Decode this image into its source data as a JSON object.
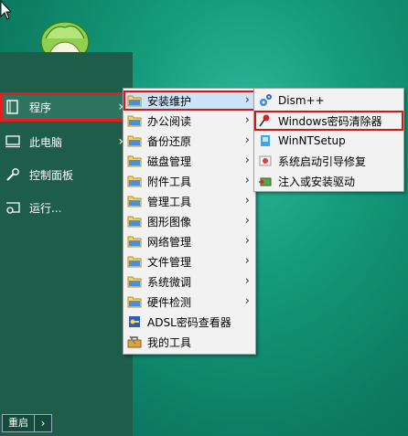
{
  "start_menu": {
    "items": [
      {
        "label": "程序",
        "icon": "programs-icon"
      },
      {
        "label": "此电脑",
        "icon": "computer-icon"
      },
      {
        "label": "控制面板",
        "icon": "wrench-icon"
      },
      {
        "label": "运行...",
        "icon": "run-icon"
      }
    ],
    "restart_label": "重启"
  },
  "programs_menu": {
    "items": [
      {
        "label": "安装维护",
        "icon": "folder-icon",
        "has_submenu": true
      },
      {
        "label": "办公阅读",
        "icon": "folder-icon",
        "has_submenu": true
      },
      {
        "label": "备份还原",
        "icon": "folder-icon",
        "has_submenu": true
      },
      {
        "label": "磁盘管理",
        "icon": "folder-icon",
        "has_submenu": true
      },
      {
        "label": "附件工具",
        "icon": "folder-icon",
        "has_submenu": true
      },
      {
        "label": "管理工具",
        "icon": "folder-icon",
        "has_submenu": true
      },
      {
        "label": "图形图像",
        "icon": "folder-icon",
        "has_submenu": true
      },
      {
        "label": "网络管理",
        "icon": "folder-icon",
        "has_submenu": true
      },
      {
        "label": "文件管理",
        "icon": "folder-icon",
        "has_submenu": true
      },
      {
        "label": "系统微调",
        "icon": "folder-icon",
        "has_submenu": true
      },
      {
        "label": "硬件检测",
        "icon": "folder-icon",
        "has_submenu": true
      },
      {
        "label": "ADSL密码查看器",
        "icon": "key-tool-icon",
        "has_submenu": false
      },
      {
        "label": "我的工具",
        "icon": "toolbox-icon",
        "has_submenu": false
      }
    ]
  },
  "install_menu": {
    "items": [
      {
        "label": "Dism++",
        "icon": "gears-icon"
      },
      {
        "label": "Windows密码清除器",
        "icon": "pin-icon"
      },
      {
        "label": "WinNTSetup",
        "icon": "setup-icon"
      },
      {
        "label": "系统启动引导修复",
        "icon": "boot-repair-icon"
      },
      {
        "label": "注入或安装驱动",
        "icon": "driver-icon"
      }
    ]
  },
  "colors": {
    "highlight_border": "#e02020",
    "menu_hover": "#cce4f7",
    "start_menu_bg": "#1e5d49"
  }
}
